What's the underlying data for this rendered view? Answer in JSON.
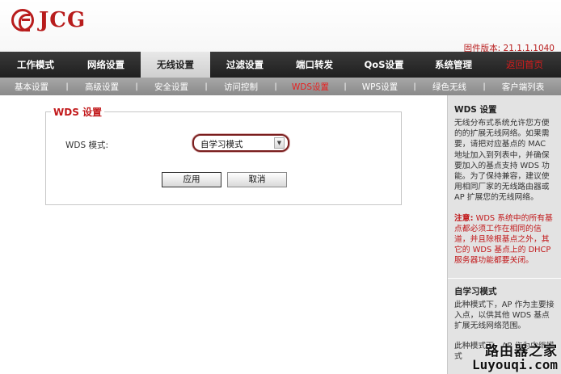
{
  "brand": {
    "logo_text": "JCG",
    "brand_color": "#b81c1c"
  },
  "firmware_label": "固件版本: 21.1.1.1040",
  "main_nav": [
    {
      "label": "工作模式"
    },
    {
      "label": "网络设置"
    },
    {
      "label": "无线设置",
      "active": true
    },
    {
      "label": "过滤设置"
    },
    {
      "label": "端口转发"
    },
    {
      "label": "QoS设置"
    },
    {
      "label": "系统管理"
    },
    {
      "label": "返回首页"
    }
  ],
  "sub_nav": [
    {
      "label": "基本设置"
    },
    {
      "label": "高级设置"
    },
    {
      "label": "安全设置"
    },
    {
      "label": "访问控制"
    },
    {
      "label": "WDS设置",
      "active": true
    },
    {
      "label": "WPS设置"
    },
    {
      "label": "绿色无线"
    },
    {
      "label": "客户端列表"
    }
  ],
  "wds": {
    "section_title": "WDS 设置",
    "mode_label": "WDS 模式:",
    "mode_value": "自学习模式",
    "apply_label": "应用",
    "cancel_label": "取消"
  },
  "help": {
    "title": "WDS 设置",
    "body": "无线分布式系统允许您方便的的扩展无线网络。如果需要，请把对应基点的 MAC 地址加入到列表中，并确保要加入的基点支持 WDS 功能。为了保持兼容，建议使用相同厂家的无线路由器或 AP 扩展您的无线网络。",
    "note_label": "注意:",
    "note_body": "WDS 系统中的所有基点都必须工作在相同的信道，并且除根基点之外，其它的 WDS 基点上的 DHCP 服务器功能都要关闭。",
    "mode_title": "自学习模式",
    "mode_body": "此种模式下，AP 作为主要接入点，以供其他 WDS 基点扩展无线网络范围。",
    "mode_body_tail": "此种模式下，AP 作为中继模式"
  },
  "watermark": {
    "cn": "路由器之家",
    "en": "Luyouqi.com"
  },
  "colors": {
    "nav_dark": "#2a2a2a",
    "subnav": "#999999",
    "accent_red": "#c2191b",
    "help_bg": "#e3e3e3"
  }
}
